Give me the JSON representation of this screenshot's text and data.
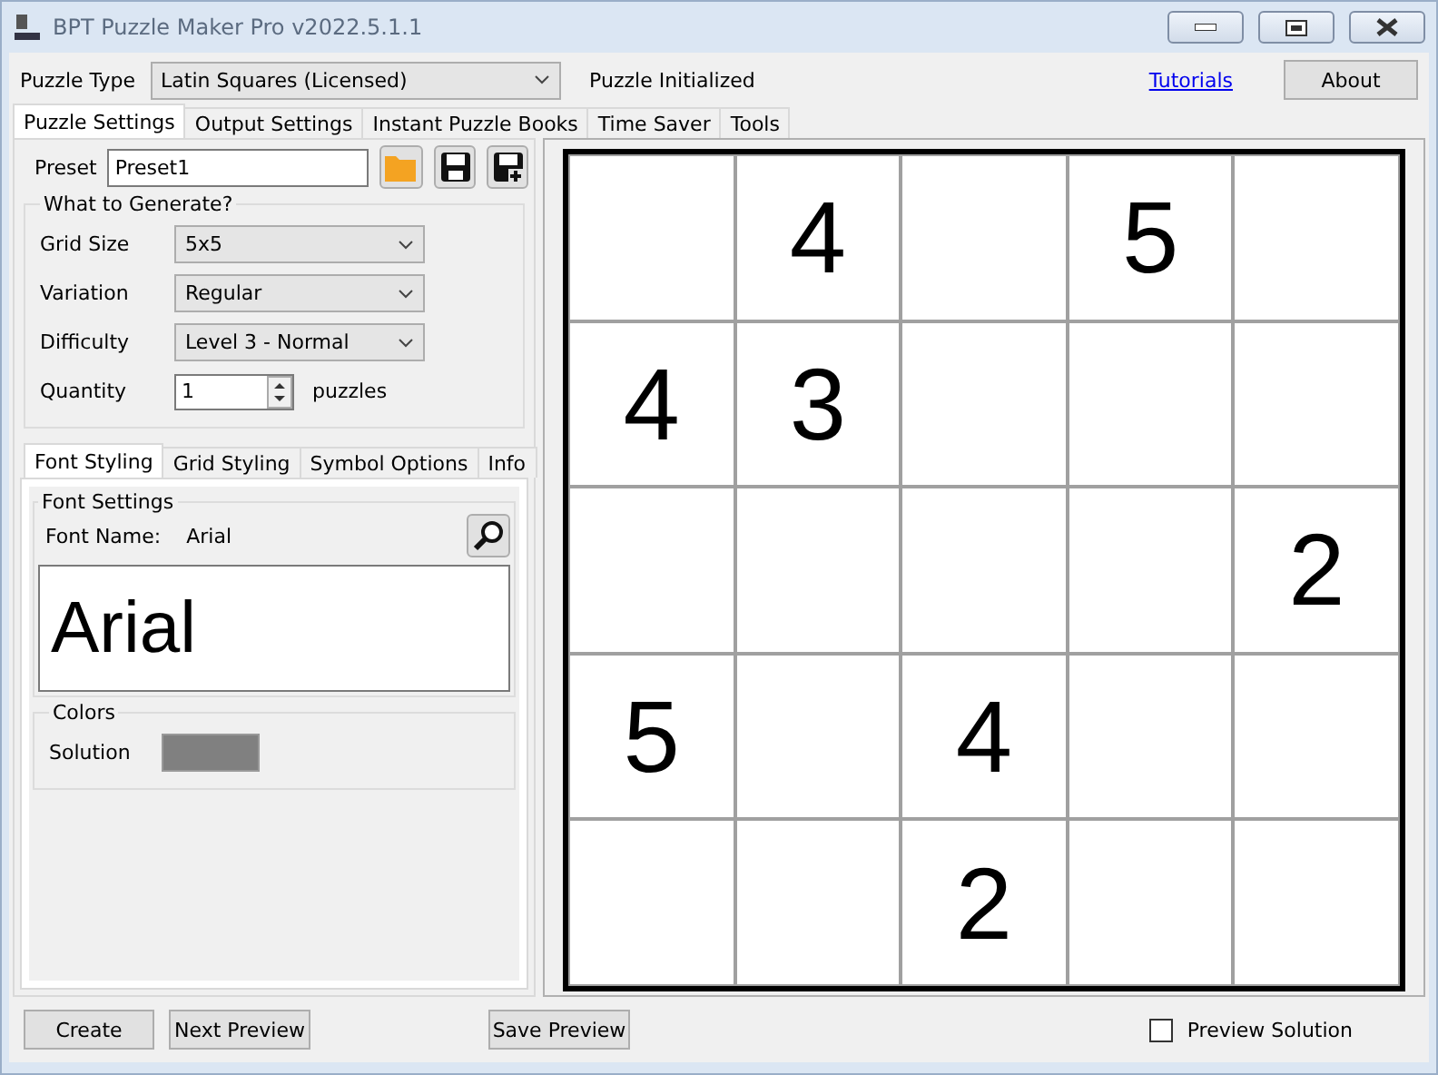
{
  "window": {
    "title": "BPT Puzzle Maker Pro v2022.5.1.1"
  },
  "top": {
    "puzzle_type_label": "Puzzle Type",
    "puzzle_type": "Latin Squares (Licensed)",
    "status": "Puzzle Initialized",
    "tutorials_link": "Tutorials",
    "about_button": "About"
  },
  "tabs": [
    {
      "label": "Puzzle Settings",
      "selected": true
    },
    {
      "label": "Output Settings",
      "selected": false
    },
    {
      "label": "Instant Puzzle Books",
      "selected": false
    },
    {
      "label": "Time Saver",
      "selected": false
    },
    {
      "label": "Tools",
      "selected": false
    }
  ],
  "preset": {
    "label": "Preset",
    "value": "Preset1"
  },
  "generate": {
    "title": "What to Generate?",
    "fields": [
      {
        "label": "Grid Size",
        "value": "5x5",
        "kind": "combo"
      },
      {
        "label": "Variation",
        "value": "Regular",
        "kind": "combo"
      },
      {
        "label": "Difficulty",
        "value": "Level 3 - Normal",
        "kind": "combo"
      },
      {
        "label": "Quantity",
        "value": "1",
        "kind": "spin",
        "unit": "puzzles"
      }
    ]
  },
  "sub_tabs": [
    {
      "label": "Font Styling",
      "selected": true
    },
    {
      "label": "Grid Styling",
      "selected": false
    },
    {
      "label": "Symbol Options",
      "selected": false
    },
    {
      "label": "Info",
      "selected": false
    }
  ],
  "font_settings": {
    "title": "Font Settings",
    "name_label": "Font Name:",
    "name": "Arial",
    "sample": "Arial"
  },
  "colors": {
    "title": "Colors",
    "items": [
      {
        "label": "Solution",
        "color": "#808080"
      }
    ]
  },
  "grid": {
    "rows": [
      {
        "cells": [
          null,
          "4",
          null,
          "5",
          null
        ]
      },
      {
        "cells": [
          "4",
          "3",
          null,
          null,
          null
        ]
      },
      {
        "cells": [
          null,
          null,
          null,
          null,
          "2"
        ]
      },
      {
        "cells": [
          "5",
          null,
          "4",
          null,
          null
        ]
      },
      {
        "cells": [
          null,
          null,
          "2",
          null,
          null
        ]
      }
    ]
  },
  "bottom": {
    "buttons": [
      "Create",
      "Next Preview",
      "Save Preview"
    ],
    "preview_solution": {
      "label": "Preview Solution",
      "checked": false
    }
  }
}
